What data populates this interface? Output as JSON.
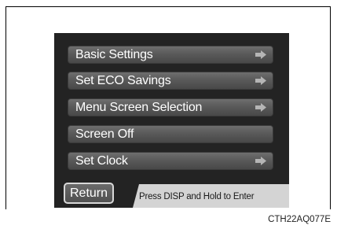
{
  "menu": {
    "items": [
      {
        "label": "Basic Settings",
        "has_arrow": true
      },
      {
        "label": "Set ECO Savings",
        "has_arrow": true
      },
      {
        "label": "Menu Screen Selection",
        "has_arrow": true
      },
      {
        "label": "Screen Off",
        "has_arrow": false
      },
      {
        "label": "Set Clock",
        "has_arrow": true
      }
    ]
  },
  "return_button": {
    "label": "Return"
  },
  "hint": {
    "text": "Press DISP and Hold to Enter"
  },
  "figure_code": "CTH22AQ077E",
  "colors": {
    "screen_bg": "#232323",
    "button_fill": "#5a5a5a",
    "hint_bg": "#d4d4d4",
    "text": "#ffffff"
  },
  "icons": {
    "menu_arrow": "arrow-right-icon"
  }
}
